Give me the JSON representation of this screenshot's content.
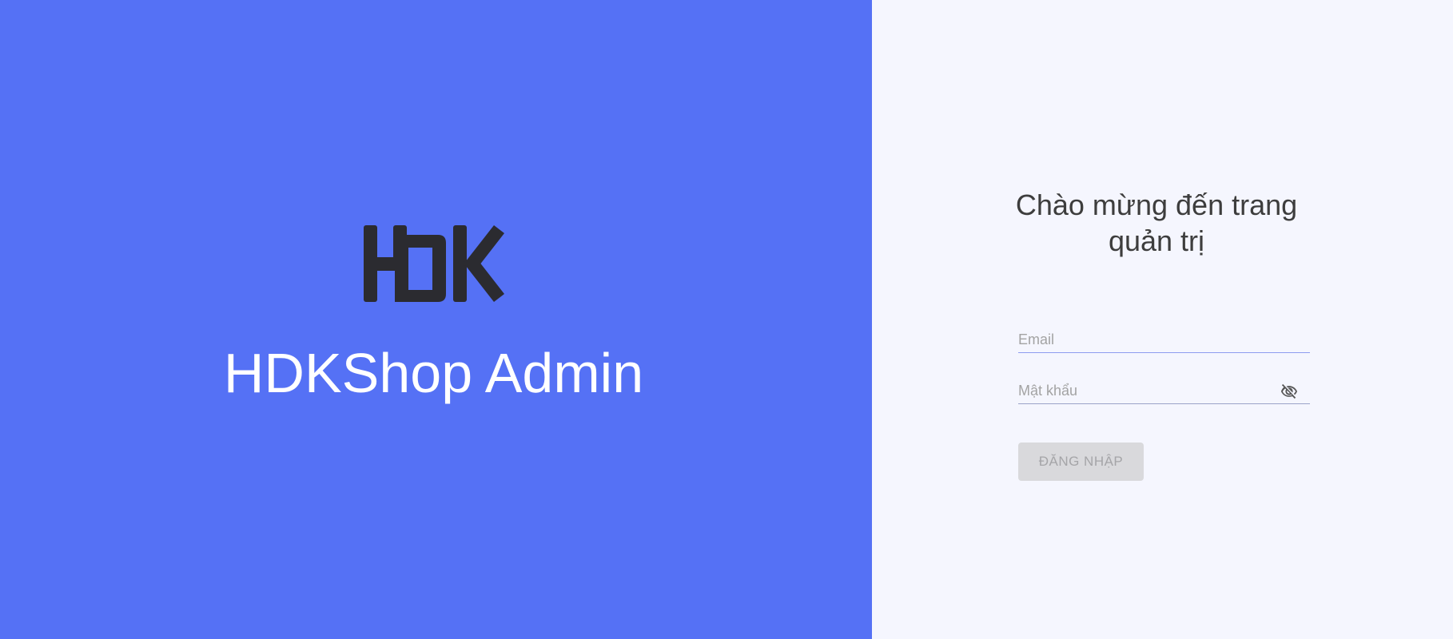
{
  "brand": {
    "logo_text": "HDK",
    "title": "HDKShop Admin",
    "panel_color": "#5571f5",
    "logo_color": "#2b2b30"
  },
  "login": {
    "welcome": "Chào mừng đến trang quản trị",
    "email_placeholder": "Email",
    "password_placeholder": "Mật khẩu",
    "password_toggle_icon": "eye-off-icon",
    "submit_label": "ĐĂNG NHẬP",
    "submit_disabled": true,
    "panel_color": "#f5f6fe"
  }
}
